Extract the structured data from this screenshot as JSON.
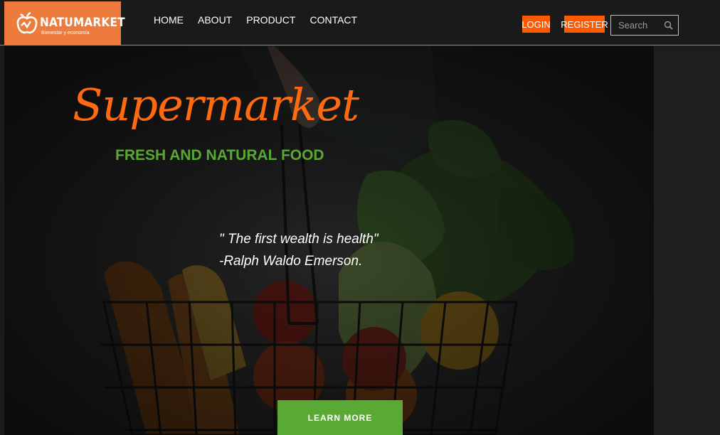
{
  "brand": {
    "name": "NATUMARKET",
    "tagline": "Bienestar y economía",
    "accent": "#ec7b3c"
  },
  "nav": {
    "items": [
      "HOME",
      "ABOUT",
      "PRODUCT",
      "CONTACT"
    ]
  },
  "auth": {
    "login_label": "LOGIN",
    "register_label": "REGISTER",
    "button_color": "#ff5a00"
  },
  "search": {
    "placeholder": "Search",
    "icon": "search-icon"
  },
  "hero": {
    "title": "Supermarket",
    "subtitle": "FRESH AND NATURAL FOOD",
    "quote": "\" The first wealth is health\"",
    "author": "-Ralph Waldo Emerson.",
    "cta_label": "LEARN MORE",
    "title_color": "#ff6a10",
    "subtitle_color": "#5aa832",
    "cta_color": "#5ba935"
  }
}
